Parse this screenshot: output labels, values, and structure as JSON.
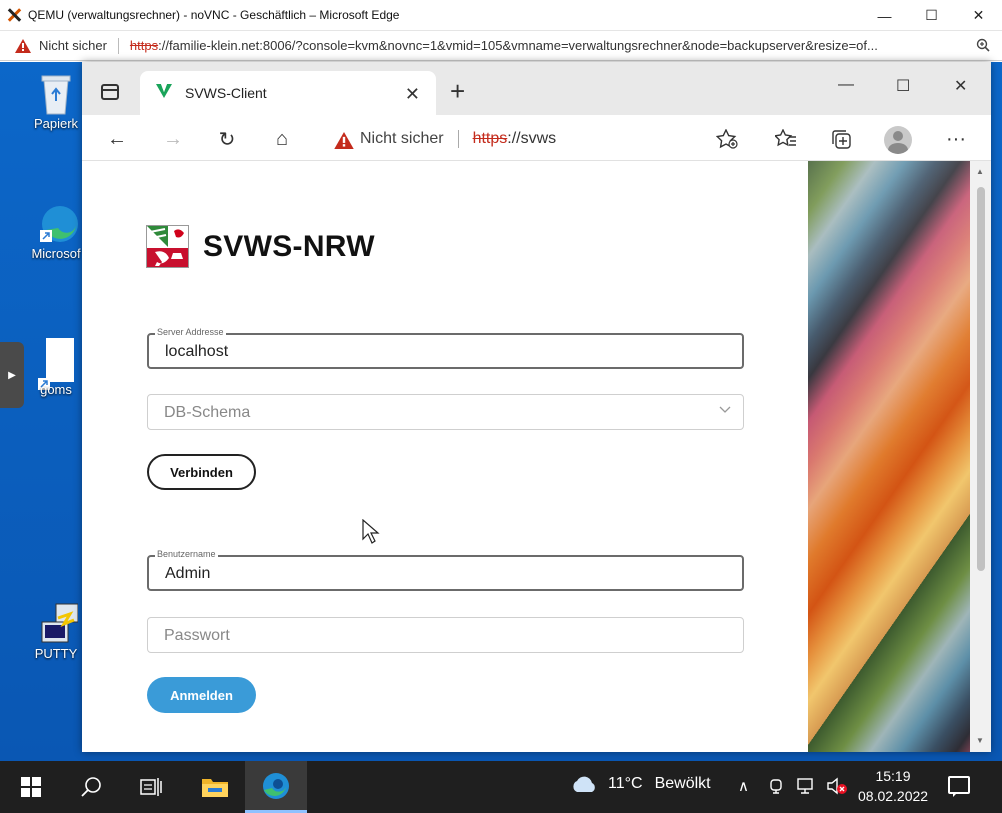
{
  "host_window": {
    "title": "QEMU (verwaltungsrechner) - noVNC - Geschäftlich – Microsoft Edge",
    "controls": {
      "minimize": "—",
      "maximize": "☐",
      "close": "✕"
    },
    "address": {
      "security": "Nicht sicher",
      "url_scheme": "https",
      "url_rest": "://familie-klein.net:8006/?console=kvm&novnc=1&vmid=105&vmname=verwaltungsrechner&node=backupserver&resize=of..."
    }
  },
  "desktop": {
    "icons": [
      {
        "label": "Papierk",
        "icon": "recycle-bin-icon"
      },
      {
        "label": "Microsof",
        "icon": "edge-shortcut-icon"
      },
      {
        "label": "goms",
        "icon": "file-shortcut-icon"
      },
      {
        "label": "PUTTY",
        "icon": "putty-icon"
      }
    ],
    "side_tab_arrow": "▶"
  },
  "edge_window": {
    "tab": {
      "title": "SVWS-Client",
      "close": "✕"
    },
    "newtab": "+",
    "controls": {
      "minimize": "—",
      "maximize": "☐",
      "close": "✕"
    },
    "toolbar": {
      "back": "←",
      "forward": "→",
      "reload": "↻",
      "home": "⌂",
      "security": "Nicht sicher",
      "url_scheme": "https",
      "url_rest": "://svws",
      "more": "···"
    }
  },
  "login_page": {
    "brand_title": "SVWS-NRW",
    "server_field": {
      "label": "Server Addresse",
      "value": "localhost"
    },
    "schema_field": {
      "placeholder": "DB-Schema",
      "chevron": "⌄"
    },
    "connect_button": "Verbinden",
    "username_field": {
      "label": "Benutzername",
      "value": "Admin"
    },
    "password_field": {
      "placeholder": "Passwort"
    },
    "login_button": "Anmelden",
    "colors": {
      "primary": "#3a9bd8"
    }
  },
  "taskbar": {
    "weather": {
      "temp": "11°C",
      "desc": "Bewölkt"
    },
    "tray": {
      "chevron": "∧"
    },
    "clock": {
      "time": "15:19",
      "date": "08.02.2022"
    }
  }
}
